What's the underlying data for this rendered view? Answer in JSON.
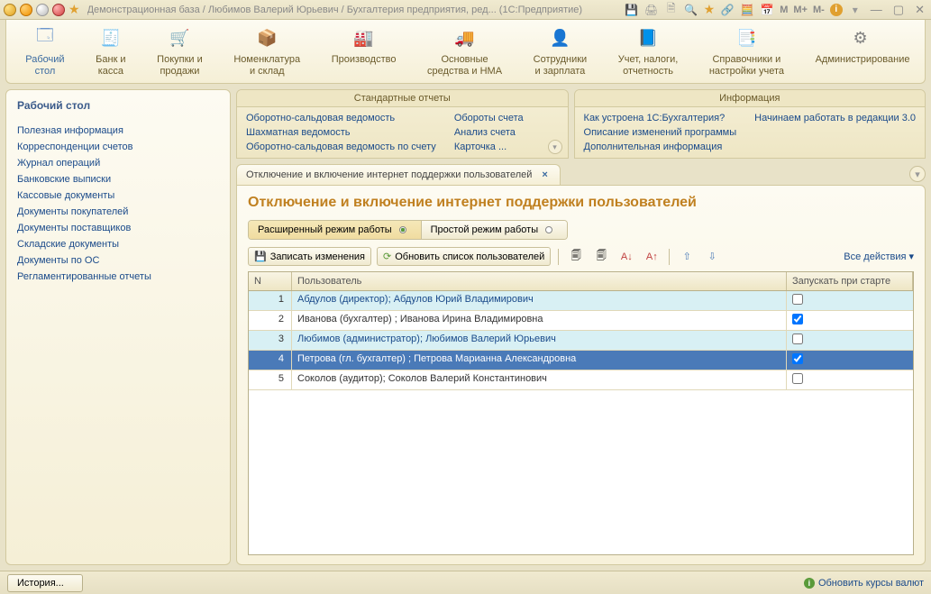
{
  "titlebar": {
    "title": "Демонстрационная база / Любимов Валерий Юрьевич / Бухгалтерия предприятия, ред...  (1С:Предприятие)",
    "m1": "M",
    "m2": "M+",
    "m3": "M-"
  },
  "ribbon": [
    {
      "label": "Рабочий\nстол",
      "icon": "🗔",
      "color": "#5a8ac8"
    },
    {
      "label": "Банк и\nкасса",
      "icon": "🧾",
      "color": "#c0a030"
    },
    {
      "label": "Покупки и\nпродажи",
      "icon": "🛒",
      "color": "#8aa040"
    },
    {
      "label": "Номенклатура\nи склад",
      "icon": "📦",
      "color": "#c08030"
    },
    {
      "label": "Производство",
      "icon": "🏭",
      "color": "#707070"
    },
    {
      "label": "Основные\nсредства и НМА",
      "icon": "🚚",
      "color": "#606060"
    },
    {
      "label": "Сотрудники\nи зарплата",
      "icon": "👤",
      "color": "#c0a030"
    },
    {
      "label": "Учет, налоги,\nотчетность",
      "icon": "📘",
      "color": "#4a9a4a"
    },
    {
      "label": "Справочники и\nнастройки учета",
      "icon": "📑",
      "color": "#c0a030"
    },
    {
      "label": "Администрирование",
      "icon": "⚙",
      "color": "#808080"
    }
  ],
  "sidebar": {
    "title": "Рабочий стол",
    "items": [
      "Полезная информация",
      "Корреспонденции счетов",
      "Журнал операций",
      "Банковские выписки",
      "Кассовые документы",
      "Документы покупателей",
      "Документы поставщиков",
      "Складские документы",
      "Документы по ОС",
      "Регламентированные отчеты"
    ]
  },
  "panels": {
    "reports": {
      "title": "Стандартные отчеты",
      "col1": [
        "Оборотно-сальдовая ведомость",
        "Шахматная ведомость",
        "Оборотно-сальдовая ведомость по счету"
      ],
      "col2": [
        "Обороты счета",
        "Анализ счета",
        "Карточка ..."
      ]
    },
    "info": {
      "title": "Информация",
      "col1": [
        "Как устроена 1С:Бухгалтерия?",
        "Описание изменений программы",
        "Дополнительная информация"
      ],
      "col2": [
        "Начинаем работать в редакции 3.0"
      ]
    }
  },
  "tab": {
    "label": "Отключение и включение интернет поддержки пользователей",
    "close": "×"
  },
  "page": {
    "title": "Отключение и включение интернет поддержки пользователей",
    "mode_ext": "Расширенный режим работы",
    "mode_simple": "Простой режим работы",
    "save": "Записать изменения",
    "refresh": "Обновить список пользователей",
    "all_actions": "Все действия",
    "table": {
      "col_n": "N",
      "col_user": "Пользователь",
      "col_start": "Запускать при старте",
      "rows": [
        {
          "n": "1",
          "user": "Абдулов (директор); Абдулов Юрий Владимирович",
          "start": false,
          "alt": true
        },
        {
          "n": "2",
          "user": "Иванова (бухгалтер) ; Иванова Ирина Владимировна",
          "start": true,
          "even": true
        },
        {
          "n": "3",
          "user": "Любимов (администратор); Любимов Валерий Юрьевич",
          "start": false,
          "alt": true
        },
        {
          "n": "4",
          "user": "Петрова (гл. бухгалтер) ; Петрова Марианна Александровна",
          "start": true,
          "selected": true
        },
        {
          "n": "5",
          "user": "Соколов (аудитор); Соколов Валерий Константинович",
          "start": false,
          "even": true
        }
      ]
    }
  },
  "footer": {
    "history": "История...",
    "update_rates": "Обновить курсы валют"
  }
}
